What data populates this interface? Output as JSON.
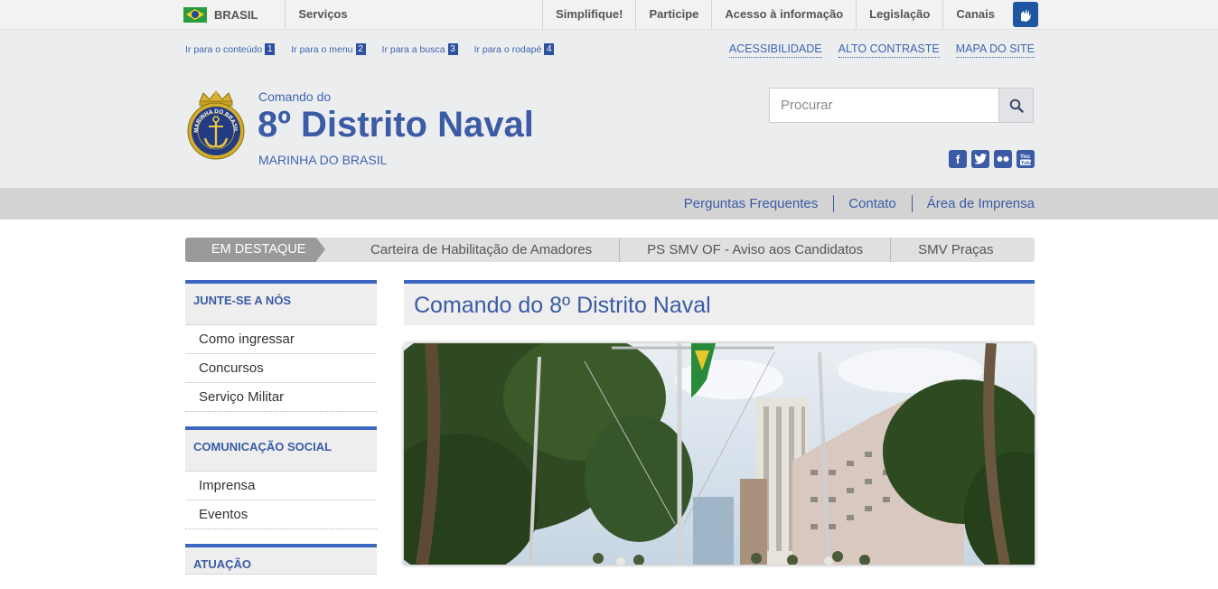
{
  "govbar": {
    "country": "BRASIL",
    "services": "Serviços",
    "links": [
      "Simplifique!",
      "Participe",
      "Acesso à informação",
      "Legislação",
      "Canais"
    ]
  },
  "accessibility_shortcuts": [
    {
      "label": "Ir para o conteúdo",
      "key": "1"
    },
    {
      "label": "Ir para o menu",
      "key": "2"
    },
    {
      "label": "Ir para a busca",
      "key": "3"
    },
    {
      "label": "Ir para o rodapé",
      "key": "4"
    }
  ],
  "top_links": [
    "ACESSIBILIDADE",
    "ALTO CONTRASTE",
    "MAPA DO SITE"
  ],
  "site": {
    "subtitle": "Comando do",
    "title": "8º Distrito Naval",
    "org": "MARINHA DO BRASIL",
    "logo_text": "MARINHA DO BRASIL"
  },
  "search": {
    "placeholder": "Procurar",
    "value": ""
  },
  "social_icons": [
    "facebook-icon",
    "twitter-icon",
    "flickr-icon",
    "youtube-icon"
  ],
  "service_links": [
    "Perguntas Frequentes",
    "Contato",
    "Área de Imprensa"
  ],
  "destaque": {
    "label": "EM DESTAQUE",
    "items": [
      "Carteira de Habilitação de Amadores",
      "PS SMV OF - Aviso aos Candidatos",
      "SMV Praças"
    ]
  },
  "sidebar": [
    {
      "title": "JUNTE-SE A NÓS",
      "items": [
        "Como ingressar",
        "Concursos",
        "Serviço Militar"
      ]
    },
    {
      "title": "COMUNICAÇÃO SOCIAL",
      "items": [
        "Imprensa",
        "Eventos"
      ]
    },
    {
      "title": "ATUAÇÃO",
      "items": []
    }
  ],
  "content": {
    "title": "Comando do 8º Distrito Naval"
  },
  "colors": {
    "brand_blue": "#3b5ba5",
    "accent_blue": "#3b67c0",
    "header_bg": "#ecedef"
  }
}
